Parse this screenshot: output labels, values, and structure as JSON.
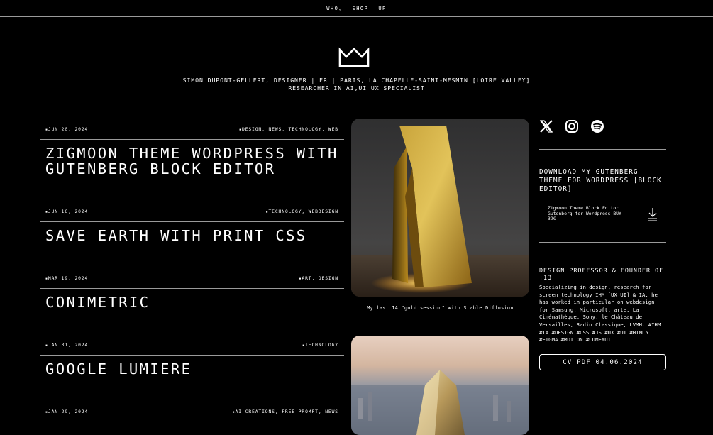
{
  "nav": {
    "items": [
      "WHO",
      "SHOP",
      "UP"
    ],
    "who_caret": "⌄"
  },
  "header": {
    "line1": "SIMON DUPONT-GELLERT, DESIGNER | FR | PARIS, LA CHAPELLE-SAINT-MESMIN [LOIRE VALLEY]",
    "line2": "RESEARCHER IN AI,UI UX SPECIALIST",
    "logo_icon": "crown-icon"
  },
  "posts": [
    {
      "date": "JUN 20, 2024",
      "tags": "DESIGN, NEWS, TECHNOLOGY, WEB",
      "title_line1": "ZIGMOON THEME WORDPRESS WITH",
      "title_line2": "GUTENBERG BLOCK EDITOR"
    },
    {
      "date": "JUN 16, 2024",
      "tags": "TECHNOLOGY, WEBDESIGN",
      "title_line1": "SAVE EARTH WITH PRINT CSS",
      "title_line2": ""
    },
    {
      "date": "MAR 19, 2024",
      "tags": "ART, DESIGN",
      "title_line1": "CONIMETRIC",
      "title_line2": ""
    },
    {
      "date": "JAN 31, 2024",
      "tags": "TECHNOLOGY",
      "title_line1": "GOOGLE LUMIERE",
      "title_line2": ""
    },
    {
      "date": "JAN 29, 2024",
      "tags": "AI CREATIONS, FREE PROMPT, NEWS",
      "title_line1": "",
      "title_line2": ""
    }
  ],
  "gallery": {
    "caption": "My last IA \"gold session\" with Stable Diffusion"
  },
  "sidebar": {
    "social_icons": [
      "x-icon",
      "instagram-icon",
      "spotify-icon"
    ],
    "download_title": "DOWNLOAD MY GUTENBERG THEME FOR WORDPRESS [BLOCK EDITOR]",
    "download_line1": "Zigmoon Theme Block Editor",
    "download_line2": "Gutenberg for Wordpress BUY",
    "download_line3": "39€",
    "download_icon": "download-icon",
    "professor_title": "DESIGN PROFESSOR & FOUNDER OF :13",
    "bio": "Specializing in design, research for screen technology IHM [UX UI] & IA, he has worked in particular on webdesign for Samsung, Microsoft, arte, La Cinémathèque, Sony, le Château de Versailles, Radio Classique, LVMH. #IHM #IA #DESIGN #CSS #JS #UX #UI #HTML5 #FIGMA #MOTION #COMFYUI",
    "cv_button": "CV PDF 04.06.2024"
  }
}
